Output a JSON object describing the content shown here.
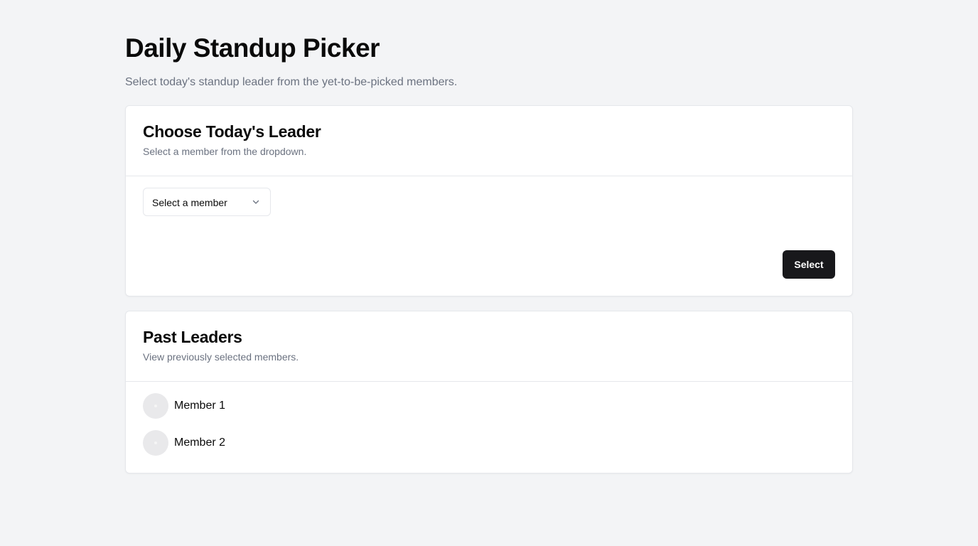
{
  "header": {
    "title": "Daily Standup Picker",
    "subtitle": "Select today's standup leader from the yet-to-be-picked members."
  },
  "choose_card": {
    "title": "Choose Today's Leader",
    "description": "Select a member from the dropdown.",
    "select_placeholder": "Select a member",
    "select_icon": "chevron-down-icon",
    "button_label": "Select"
  },
  "past_card": {
    "title": "Past Leaders",
    "description": "View previously selected members.",
    "members": [
      {
        "name": "Member 1",
        "avatar_icon": "avatar-placeholder"
      },
      {
        "name": "Member 2",
        "avatar_icon": "avatar-placeholder"
      }
    ]
  },
  "colors": {
    "background": "#f3f4f6",
    "card": "#ffffff",
    "border": "#e5e7eb",
    "muted_text": "#6b7280",
    "primary_button": "#18181b"
  }
}
